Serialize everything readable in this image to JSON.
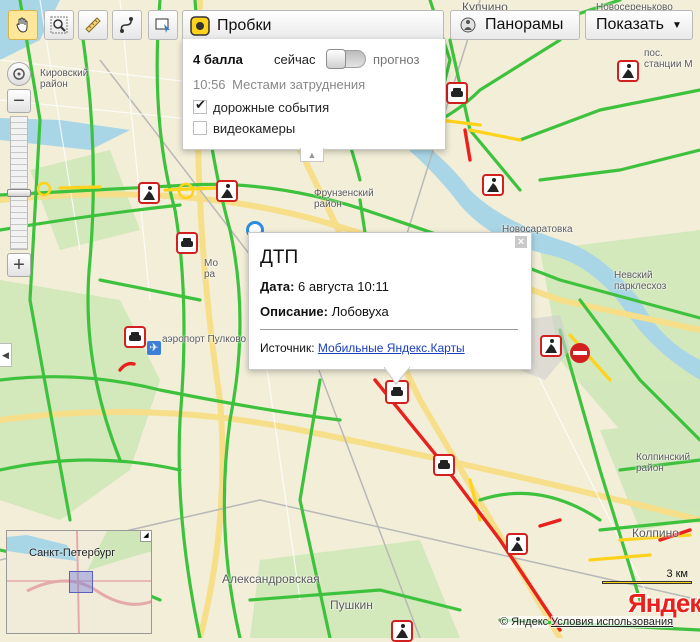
{
  "toolbar": {
    "traffic_label": "Пробки",
    "panoramas_label": "Панорамы",
    "show_label": "Показать"
  },
  "traffic_panel": {
    "score": "4 балла",
    "now_label": "сейчас",
    "forecast_label": "прогноз",
    "time": "10:56",
    "status": "Местами затруднения",
    "road_events_label": "дорожные события",
    "road_events_checked": true,
    "cameras_label": "видеокамеры",
    "cameras_checked": false
  },
  "incident_popup": {
    "title": "ДТП",
    "date_label": "Дата:",
    "date_value": "6 августа 10:11",
    "desc_label": "Описание:",
    "desc_value": "Лобовуха",
    "source_label": "Источник:",
    "source_link": "Мобильные Яндекс.Карты"
  },
  "map_labels": {
    "kirovsky": "Кировский\nрайон",
    "frunzensky": "Фрунзенский\nрайон",
    "kupchino": "Купчино",
    "novosaratovka": "Новосаратовка",
    "novoserenkoye": "Новосереньково",
    "station": "пос.\nстанции М",
    "nevsky": "Невский\nпарклесхоз",
    "kolpino": "Колпинский\nрайон",
    "kolpino_city": "Колпино",
    "alexandrovskaya": "Александровская",
    "pushkin": "Пушкин",
    "airport": "аэропорт Пулково",
    "moskovsky": "Мо\nра"
  },
  "minimap": {
    "city": "Санкт-Петербург"
  },
  "scale": {
    "label": "3 км"
  },
  "footer": {
    "copyright": "© Яндекс",
    "terms": "Условия использования",
    "logo": "Яндекс"
  },
  "colors": {
    "traffic_green": "#3ec23e",
    "traffic_yellow": "#ffd21c",
    "traffic_red": "#e8211c",
    "road_yellow": "#f7df8a",
    "water": "#a9d6e6",
    "land": "#f2eed8"
  }
}
